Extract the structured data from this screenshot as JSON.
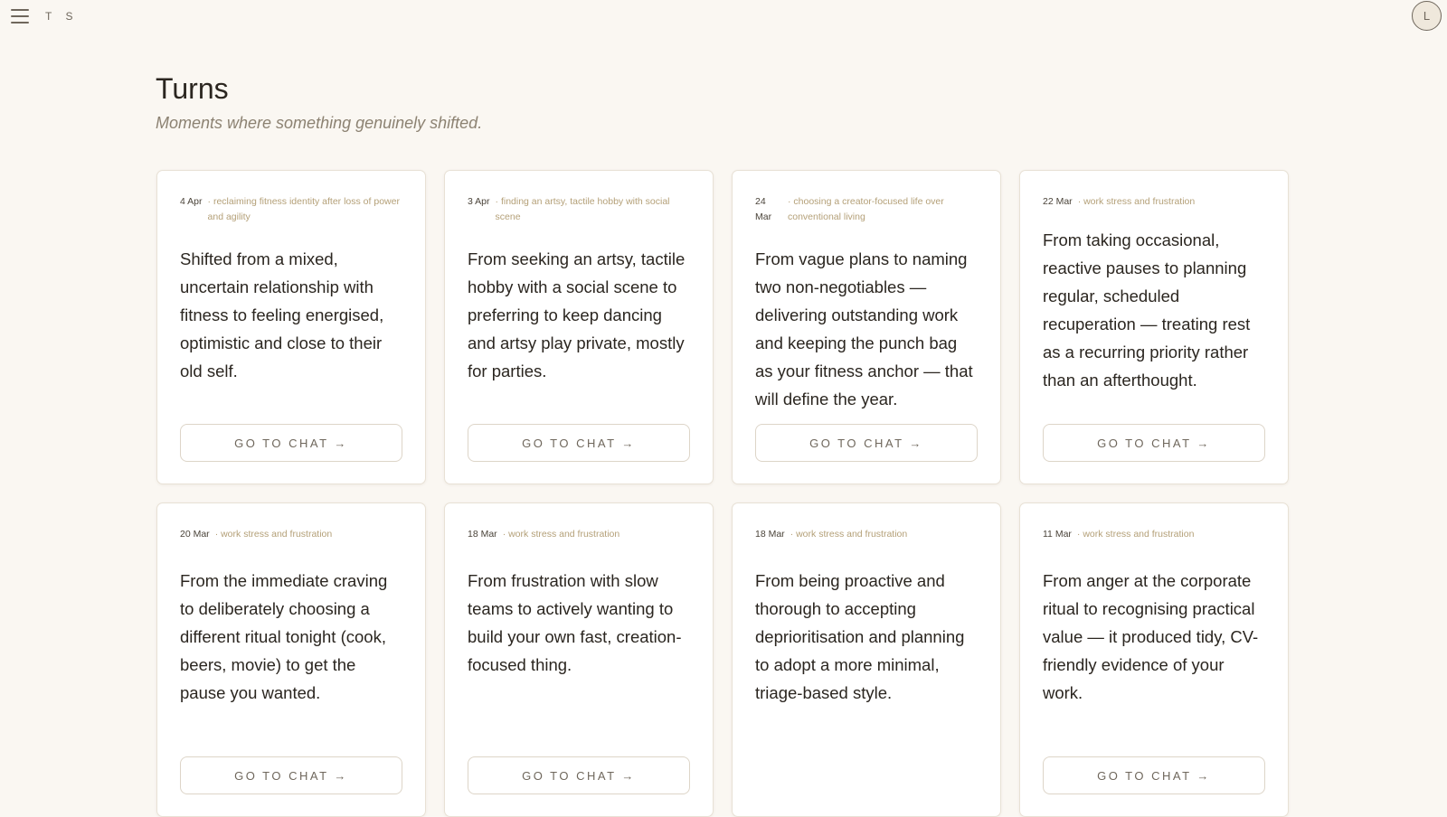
{
  "app": {
    "brand": "T S",
    "avatar_initial": "L"
  },
  "page": {
    "title": "Turns",
    "subtitle": "Moments where something genuinely shifted."
  },
  "cards": [
    {
      "date": "4 Apr",
      "tag": "· reclaiming fitness identity after loss of power and agility",
      "summary": "Shifted from a mixed, uncertain relationship with fitness to feeling energised, optimistic and close to their old self.",
      "button_label": "GO TO CHAT →"
    },
    {
      "date": "3 Apr",
      "tag": "· finding an artsy, tactile hobby with social scene",
      "summary": "From seeking an artsy, tactile hobby with a social scene to preferring to keep dancing and artsy play private, mostly for parties.",
      "button_label": "GO TO CHAT →"
    },
    {
      "date": "24 Mar",
      "tag": "· choosing a creator-focused life over conventional living",
      "summary": "From vague plans to naming two non-negotiables — delivering outstanding work and keeping the punch bag as your fitness anchor — that will define the year.",
      "button_label": "GO TO CHAT →"
    },
    {
      "date": "22 Mar",
      "tag": "· work stress and frustration",
      "summary": "From taking occasional, reactive pauses to planning regular, scheduled recuperation — treating rest as a recurring priority rather than an afterthought.",
      "button_label": "GO TO CHAT →"
    },
    {
      "date": "20 Mar",
      "tag": "· work stress and frustration",
      "summary": "From the immediate craving to deliberately choosing a different ritual tonight (cook, beers, movie) to get the pause you wanted.",
      "button_label": "GO TO CHAT →"
    },
    {
      "date": "18 Mar",
      "tag": "· work stress and frustration",
      "summary": "From frustration with slow teams to actively wanting to build your own fast, creation-focused thing.",
      "button_label": "GO TO CHAT →"
    },
    {
      "date": "18 Mar",
      "tag": "· work stress and frustration",
      "summary": "From being proactive and thorough to accepting deprioritisation and planning to adopt a more minimal, triage-based style.",
      "button_label": ""
    },
    {
      "date": "11 Mar",
      "tag": "· work stress and frustration",
      "summary": "From anger at the corporate ritual to recognising practical value — it produced tidy, CV-friendly evidence of your work.",
      "button_label": "GO TO CHAT →"
    }
  ]
}
